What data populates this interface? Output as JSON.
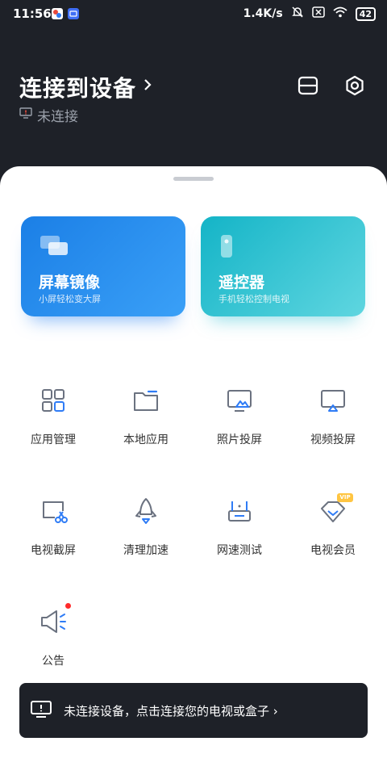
{
  "status_bar": {
    "time": "11:56",
    "speed": "1.4K/s",
    "battery": "42"
  },
  "header": {
    "title": "连接到设备",
    "subtitle": "未连接"
  },
  "cards": {
    "mirror": {
      "title": "屏幕镜像",
      "subtitle": "小屏轻松变大屏"
    },
    "remote": {
      "title": "遥控器",
      "subtitle": "手机轻松控制电视"
    }
  },
  "grid": {
    "items": [
      {
        "label": "应用管理",
        "icon": "app-grid-icon"
      },
      {
        "label": "本地应用",
        "icon": "folder-icon"
      },
      {
        "label": "照片投屏",
        "icon": "photo-cast-icon"
      },
      {
        "label": "视频投屏",
        "icon": "video-cast-icon"
      },
      {
        "label": "电视截屏",
        "icon": "screenshot-icon"
      },
      {
        "label": "清理加速",
        "icon": "rocket-icon"
      },
      {
        "label": "网速测试",
        "icon": "router-icon"
      },
      {
        "label": "电视会员",
        "icon": "diamond-icon",
        "badge": "VIP"
      },
      {
        "label": "公告",
        "icon": "megaphone-icon"
      }
    ]
  },
  "banner": {
    "text": "未连接设备，点击连接您的电视或盒子 ›"
  },
  "colors": {
    "dark_bg": "#1e2128",
    "icon_gray": "#6b7280",
    "icon_blue": "#2f7cf6",
    "mirror_card": "#2a8ff0",
    "remote_card": "#2fc4d2"
  }
}
